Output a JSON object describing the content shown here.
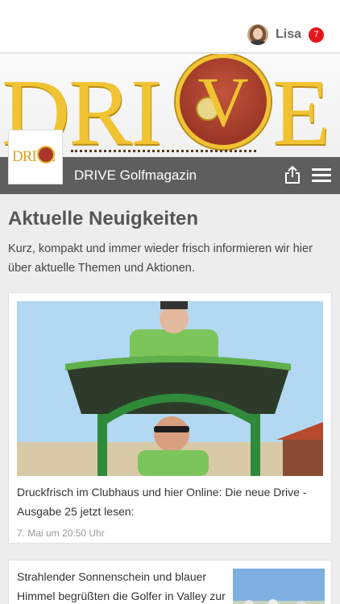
{
  "user": {
    "name": "Lisa",
    "notification_count": "7"
  },
  "banner": {
    "brand_left": "DRI",
    "brand_center": "V",
    "brand_right": "E"
  },
  "header": {
    "title": "DRIVE Golfmagazin",
    "logo_text": "DRIVE"
  },
  "section": {
    "title": "Aktuelle Neuigkeiten",
    "description": "Kurz, kompakt und immer wieder frisch informieren wir hier über aktuelle Themen und Aktionen."
  },
  "articles": [
    {
      "text": "Druckfrisch im Clubhaus und hier Online: Die neue Drive - Ausgabe 25 jetzt lesen:",
      "date": "7. Mai um 20:50 Uhr"
    },
    {
      "text": "Strahlender Sonnenschein und blauer Himmel begrüßten die Golfer in Valley zur"
    }
  ],
  "colors": {
    "accent": "#e3161c",
    "brand_gold": "#f1c332",
    "brand_red": "#a8392a",
    "header_bg": "#5e5e5e"
  },
  "icons": [
    "share-icon",
    "menu-icon"
  ]
}
